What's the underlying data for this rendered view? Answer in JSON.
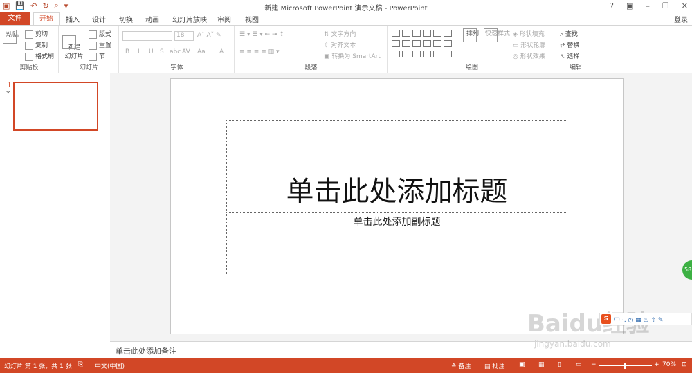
{
  "titlebar": {
    "title": "新建 Microsoft PowerPoint 演示文稿 - PowerPoint",
    "qat": [
      "▣",
      "💾",
      "↶",
      "↻",
      "⌕",
      "▾"
    ],
    "win_controls": [
      "?",
      "▣",
      "–",
      "❐",
      "✕"
    ]
  },
  "tabs": {
    "file": "文件",
    "items": [
      "开始",
      "插入",
      "设计",
      "切换",
      "动画",
      "幻灯片放映",
      "审阅",
      "视图"
    ],
    "login": "登录"
  },
  "ribbon": {
    "clipboard": {
      "label": "剪贴板",
      "paste": "粘贴",
      "cut": "剪切",
      "copy": "复制",
      "painter": "格式刷"
    },
    "slides": {
      "label": "幻灯片",
      "new_slide": "新建\n幻灯片",
      "layout": "版式",
      "reset": "重置",
      "section": "节"
    },
    "font": {
      "label": "字体",
      "font_name": "",
      "font_size": "18",
      "buttons": [
        "B",
        "I",
        "U",
        "S",
        "abc",
        "AV",
        "Aa",
        "A"
      ]
    },
    "paragraph": {
      "label": "段落",
      "text_direction": "文字方向",
      "align_text": "对齐文本",
      "smartart": "转换为 SmartArt"
    },
    "drawing": {
      "label": "绘图",
      "arrange": "排列",
      "quick_styles": "快速样式",
      "shape_fill": "形状填充",
      "shape_outline": "形状轮廓",
      "shape_effects": "形状效果"
    },
    "editing": {
      "label": "编辑",
      "find": "查找",
      "replace": "替换",
      "select": "选择"
    }
  },
  "slides_panel": {
    "number": "1",
    "star": "*"
  },
  "slide": {
    "title_placeholder": "单击此处添加标题",
    "subtitle_placeholder": "单击此处添加副标题"
  },
  "notes": {
    "placeholder": "单击此处添加备注"
  },
  "statusbar": {
    "slide_info": "幻灯片 第 1 张，共 1 张",
    "language": "中文(中国)",
    "notes_btn": "备注",
    "comments_btn": "批注",
    "zoom": "70%"
  },
  "overlays": {
    "badge": "58",
    "floatbar_logo": "S",
    "floatbar_text": "中 ·, ◷ ▦ ♨ ⇧ ✎",
    "watermark": "Baidu经验",
    "watermark_url": "jingyan.baidu.com"
  }
}
